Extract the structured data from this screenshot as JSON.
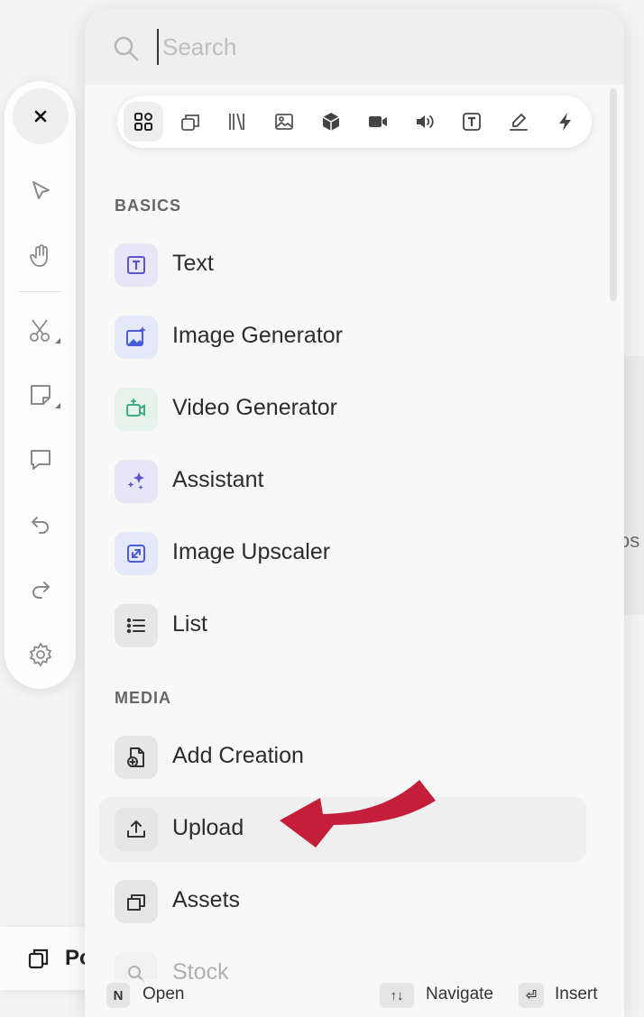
{
  "search": {
    "placeholder": "Search",
    "value": ""
  },
  "filters": [
    {
      "icon": "grid-icon",
      "active": true
    },
    {
      "icon": "layers-icon"
    },
    {
      "icon": "library-icon"
    },
    {
      "icon": "image-icon"
    },
    {
      "icon": "cube-icon"
    },
    {
      "icon": "video-camera-icon"
    },
    {
      "icon": "speaker-icon"
    },
    {
      "icon": "text-box-icon"
    },
    {
      "icon": "signature-pen-icon"
    },
    {
      "icon": "lightning-icon"
    }
  ],
  "toolbar": {
    "tools": [
      "close-icon",
      "pointer-icon",
      "hand-icon",
      "scissors-icon",
      "sticky-note-icon",
      "comment-icon",
      "undo-icon",
      "redo-icon",
      "settings-icon"
    ]
  },
  "sections": {
    "basics": {
      "title": "BASICS",
      "items": [
        {
          "label": "Text",
          "icon": "text-icon"
        },
        {
          "label": "Image Generator",
          "icon": "image-sparkle-icon"
        },
        {
          "label": "Video Generator",
          "icon": "video-sparkle-icon"
        },
        {
          "label": "Assistant",
          "icon": "sparkles-icon"
        },
        {
          "label": "Image Upscaler",
          "icon": "upscale-icon"
        },
        {
          "label": "List",
          "icon": "list-icon"
        }
      ]
    },
    "media": {
      "title": "MEDIA",
      "items": [
        {
          "label": "Add Creation",
          "icon": "add-file-icon"
        },
        {
          "label": "Upload",
          "icon": "upload-icon",
          "highlighted": true
        },
        {
          "label": "Assets",
          "icon": "assets-icon"
        },
        {
          "label": "Stock",
          "icon": "search-icon"
        }
      ]
    }
  },
  "footer": {
    "open_key": "N",
    "open_label": "Open",
    "navigate_key": "↑↓",
    "navigate_label": "Navigate",
    "insert_key": "⏎",
    "insert_label": "Insert"
  },
  "background": {
    "right_text": "os",
    "bottom_text": "Po"
  },
  "colors": {
    "accent_purple": "#5b55c9",
    "accent_green": "#3fae7c",
    "annotation_red": "#c41e3a"
  }
}
